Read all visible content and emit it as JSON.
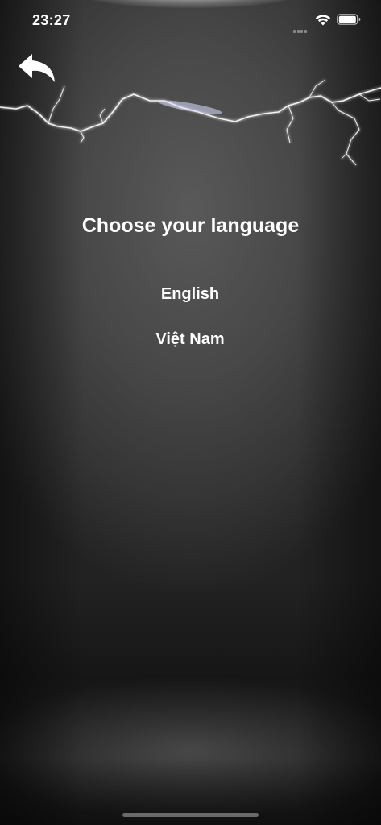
{
  "status_bar": {
    "time": "23:27",
    "signal_icon": "cellular-signal-icon",
    "wifi_icon": "wifi-icon",
    "battery_icon": "battery-full-icon"
  },
  "header": {
    "back_icon": "curved-back-arrow-icon",
    "decoration_icon": "lightning-bolt-icon"
  },
  "main": {
    "title": "Choose your language",
    "languages": [
      {
        "label": "English"
      },
      {
        "label": "Việt Nam"
      }
    ]
  },
  "colors": {
    "text": "#ffffff",
    "background": "#3a3a3a"
  }
}
